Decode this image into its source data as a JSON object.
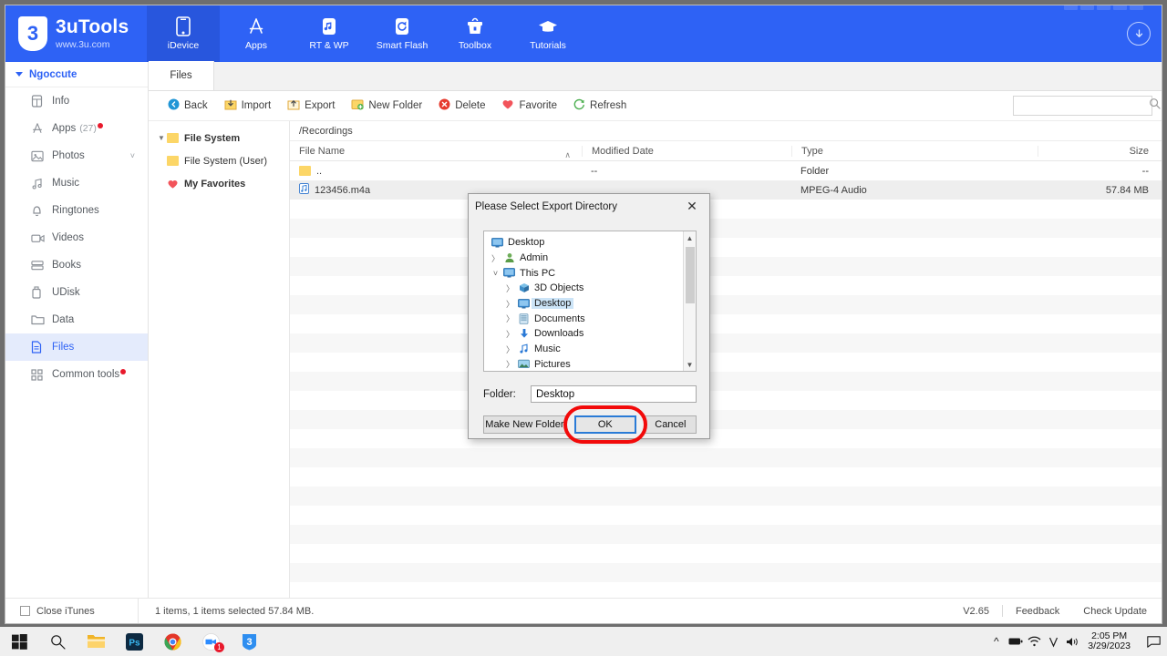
{
  "app": {
    "brand_mark": "3",
    "brand_title": "3uTools",
    "brand_url": "www.3u.com",
    "accent": "#2e62f5"
  },
  "topnav": {
    "items": [
      {
        "label": "iDevice",
        "icon": "phone-icon",
        "active": true
      },
      {
        "label": "Apps",
        "icon": "appstore-icon",
        "active": false
      },
      {
        "label": "RT & WP",
        "icon": "ringtone-wallpaper-icon",
        "active": false
      },
      {
        "label": "Smart Flash",
        "icon": "refresh-icon",
        "active": false
      },
      {
        "label": "Toolbox",
        "icon": "toolbox-icon",
        "active": false
      },
      {
        "label": "Tutorials",
        "icon": "graduation-cap-icon",
        "active": false
      }
    ],
    "download_icon": "download-arrow-icon"
  },
  "sidebar": {
    "device_name": "Ngoccute",
    "items": [
      {
        "label": "Info",
        "icon": "info-device-icon",
        "count": "",
        "dot": false,
        "chevron": false,
        "active": false
      },
      {
        "label": "Apps",
        "icon": "appstore-icon",
        "count": "(27)",
        "dot": true,
        "chevron": false,
        "active": false
      },
      {
        "label": "Photos",
        "icon": "photo-icon",
        "count": "",
        "dot": false,
        "chevron": true,
        "active": false
      },
      {
        "label": "Music",
        "icon": "music-note-icon",
        "count": "",
        "dot": false,
        "chevron": false,
        "active": false
      },
      {
        "label": "Ringtones",
        "icon": "bell-icon",
        "count": "",
        "dot": false,
        "chevron": false,
        "active": false
      },
      {
        "label": "Videos",
        "icon": "video-camera-icon",
        "count": "",
        "dot": false,
        "chevron": false,
        "active": false
      },
      {
        "label": "Books",
        "icon": "books-icon",
        "count": "",
        "dot": false,
        "chevron": false,
        "active": false
      },
      {
        "label": "UDisk",
        "icon": "usb-disk-icon",
        "count": "",
        "dot": false,
        "chevron": false,
        "active": false
      },
      {
        "label": "Data",
        "icon": "folder-icon",
        "count": "",
        "dot": false,
        "chevron": false,
        "active": false
      },
      {
        "label": "Files",
        "icon": "document-icon",
        "count": "",
        "dot": false,
        "chevron": false,
        "active": true
      },
      {
        "label": "Common tools",
        "icon": "grid-icon",
        "count": "",
        "dot": true,
        "chevron": false,
        "active": false
      }
    ]
  },
  "tabs": [
    {
      "label": "Files",
      "active": true
    }
  ],
  "toolbar": {
    "buttons": [
      {
        "label": "Back",
        "icon": "back-circle-icon"
      },
      {
        "label": "Import",
        "icon": "import-icon"
      },
      {
        "label": "Export",
        "icon": "export-icon"
      },
      {
        "label": "New Folder",
        "icon": "new-folder-icon"
      },
      {
        "label": "Delete",
        "icon": "delete-circle-icon"
      },
      {
        "label": "Favorite",
        "icon": "heart-icon"
      },
      {
        "label": "Refresh",
        "icon": "refresh-circle-icon"
      }
    ],
    "search_value": "",
    "search_placeholder": "",
    "search_icon": "search-icon"
  },
  "tree": {
    "nodes": [
      {
        "label": "File System",
        "icon": "folder-icon",
        "expanded": true,
        "bold": true,
        "indent": 0
      },
      {
        "label": "File System (User)",
        "icon": "folder-icon",
        "expanded": false,
        "bold": false,
        "indent": 1
      },
      {
        "label": "My Favorites",
        "icon": "heart-icon",
        "expanded": false,
        "bold": true,
        "indent": 1
      }
    ]
  },
  "filelist": {
    "path": "/Recordings",
    "columns": [
      "File Name",
      "Modified Date",
      "Type",
      "Size"
    ],
    "sort_indicator": "∧",
    "rows": [
      {
        "name": "..",
        "icon": "folder-icon",
        "modified": "--",
        "type": "Folder",
        "size": "--"
      },
      {
        "name": "123456.m4a",
        "icon": "audio-file-icon",
        "modified": "",
        "type": "MPEG-4 Audio",
        "size": "57.84 MB"
      }
    ]
  },
  "statusbar": {
    "close_itunes_label": "Close iTunes",
    "close_itunes_checked": false,
    "info": "1 items, 1 items selected 57.84 MB.",
    "version": "V2.65",
    "feedback": "Feedback",
    "check_update": "Check Update"
  },
  "dialog": {
    "title": "Please Select Export Directory",
    "close_icon": "close-icon",
    "tree": [
      {
        "label": "Desktop",
        "icon": "monitor-icon",
        "chevron": "",
        "indent": 0,
        "selected": false
      },
      {
        "label": "Admin",
        "icon": "user-icon",
        "chevron": ">",
        "indent": 1,
        "selected": false
      },
      {
        "label": "This PC",
        "icon": "monitor-icon",
        "chevron": "v",
        "indent": 1,
        "selected": false
      },
      {
        "label": "3D Objects",
        "icon": "cube-icon",
        "chevron": ">",
        "indent": 2,
        "selected": false
      },
      {
        "label": "Desktop",
        "icon": "monitor-icon",
        "chevron": ">",
        "indent": 2,
        "selected": true
      },
      {
        "label": "Documents",
        "icon": "documents-icon",
        "chevron": ">",
        "indent": 2,
        "selected": false
      },
      {
        "label": "Downloads",
        "icon": "download-arrow-icon",
        "chevron": ">",
        "indent": 2,
        "selected": false
      },
      {
        "label": "Music",
        "icon": "music-note-icon",
        "chevron": ">",
        "indent": 2,
        "selected": false
      },
      {
        "label": "Pictures",
        "icon": "pictures-icon",
        "chevron": ">",
        "indent": 2,
        "selected": false
      }
    ],
    "folder_label": "Folder:",
    "folder_value": "Desktop",
    "make_new_folder": "Make New Folder",
    "ok": "OK",
    "cancel": "Cancel",
    "highlight_color": "#f20a0a"
  },
  "taskbar": {
    "items": [
      {
        "icon": "windows-start-icon"
      },
      {
        "icon": "search-icon"
      },
      {
        "icon": "file-explorer-icon"
      },
      {
        "icon": "photoshop-icon"
      },
      {
        "icon": "chrome-icon"
      },
      {
        "icon": "zoom-icon",
        "badge": "1"
      },
      {
        "icon": "3utools-icon"
      }
    ],
    "tray": [
      {
        "icon": "chevron-up-icon"
      },
      {
        "icon": "battery-icon"
      },
      {
        "icon": "wifi-icon"
      },
      {
        "icon": "v-icon"
      },
      {
        "icon": "volume-icon"
      }
    ],
    "time": "2:05 PM",
    "date": "3/29/2023",
    "action_center_icon": "notification-icon"
  }
}
